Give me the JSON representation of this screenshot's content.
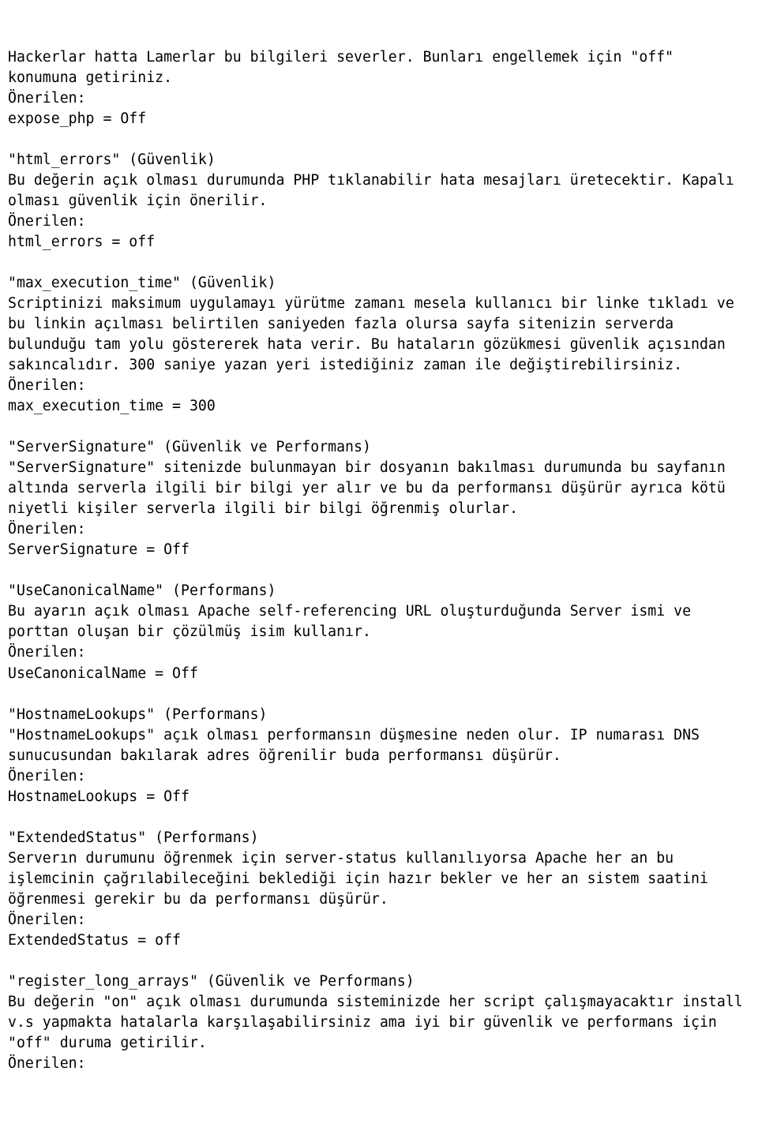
{
  "sections": [
    {
      "text": "Hackerlar hatta Lamerlar bu bilgileri severler. Bunları engellemek için \"off\" konumuna getiriniz.\nÖnerilen:\nexpose_php = Off\n\n\"html_errors\" (Güvenlik)\nBu değerin açık olması durumunda PHP tıklanabilir hata mesajları üretecektir. Kapalı olması güvenlik için önerilir.\nÖnerilen:\nhtml_errors = off\n\n\"max_execution_time\" (Güvenlik)\nScriptinizi maksimum uygulamayı yürütme zamanı mesela kullanıcı bir linke tıkladı ve bu linkin açılması belirtilen saniyeden fazla olursa sayfa sitenizin serverda bulunduğu tam yolu göstererek hata verir. Bu hataların gözükmesi güvenlik açısından sakıncalıdır. 300 saniye yazan yeri istediğiniz zaman ile değiştirebilirsiniz.\nÖnerilen:\nmax_execution_time = 300\n\n\"ServerSignature\" (Güvenlik ve Performans)\n\"ServerSignature\" sitenizde bulunmayan bir dosyanın bakılması durumunda bu sayfanın altında serverla ilgili bir bilgi yer alır ve bu da performansı düşürür ayrıca kötü niyetli kişiler serverla ilgili bir bilgi öğrenmiş olurlar.\nÖnerilen:\nServerSignature = Off\n\n\"UseCanonicalName\" (Performans)\nBu ayarın açık olması Apache self-referencing URL oluşturduğunda Server ismi ve porttan oluşan bir çözülmüş isim kullanır.\nÖnerilen:\nUseCanonicalName = Off\n\n\"HostnameLookups\" (Performans)\n\"HostnameLookups\" açık olması performansın düşmesine neden olur. IP numarası DNS sunucusundan bakılarak adres öğrenilir buda performansı düşürür.\nÖnerilen:\nHostnameLookups = Off\n\n\"ExtendedStatus\" (Performans)\nServerın durumunu öğrenmek için server-status kullanılıyorsa Apache her an bu işlemcinin çağrılabileceğini beklediği için hazır bekler ve her an sistem saatini öğrenmesi gerekir bu da performansı düşürür.\nÖnerilen:\nExtendedStatus = off\n\n\"register_long_arrays\" (Güvenlik ve Performans)\nBu değerin \"on\" açık olması durumunda sisteminizde her script çalışmayacaktır install v.s yapmakta hatalarla karşılaşabilirsiniz ama iyi bir güvenlik ve performans için \"off\" duruma getirilir.\nÖnerilen:"
    }
  ]
}
